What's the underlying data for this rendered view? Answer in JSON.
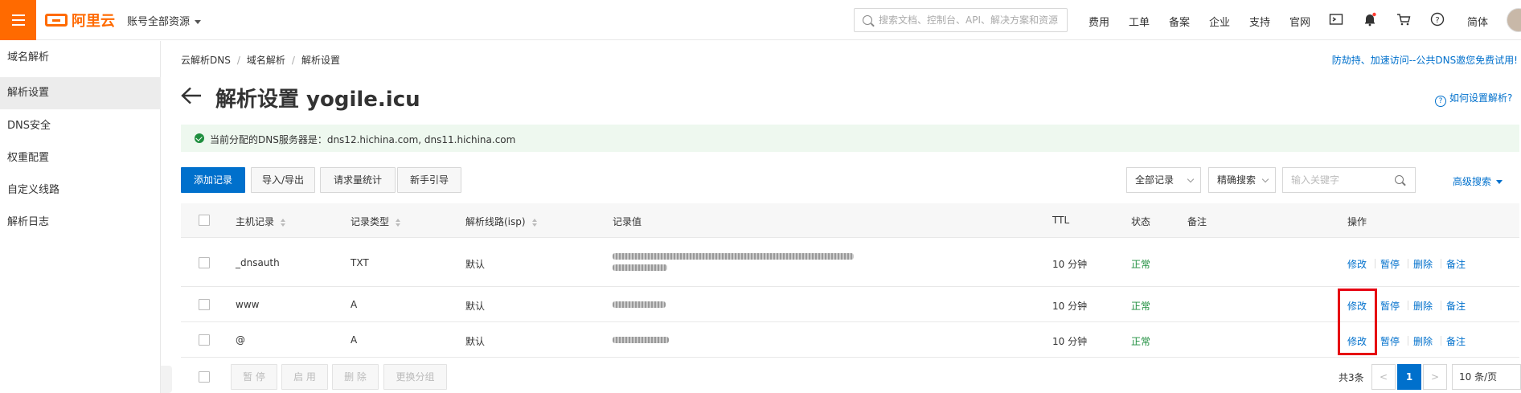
{
  "topbar": {
    "logo_text": "阿里云",
    "account_label": "账号全部资源",
    "search_placeholder": "搜索文档、控制台、API、解决方案和资源",
    "nav": [
      "费用",
      "工单",
      "备案",
      "企业",
      "支持",
      "官网"
    ],
    "lang": "简体"
  },
  "sidebar": {
    "items": [
      {
        "label": "域名解析"
      },
      {
        "label": "解析设置"
      },
      {
        "label": "DNS安全"
      },
      {
        "label": "权重配置"
      },
      {
        "label": "自定义线路"
      },
      {
        "label": "解析日志"
      }
    ]
  },
  "breadcrumb": [
    "云解析DNS",
    "域名解析",
    "解析设置"
  ],
  "promo_link": "防劫持、加速访问--公共DNS邀您免费试用!",
  "page_title": "解析设置 yogile.icu",
  "help_link": "如何设置解析?",
  "notice": "当前分配的DNS服务器是：dns12.hichina.com, dns11.hichina.com",
  "toolbar": {
    "add": "添加记录",
    "import_export": "导入/导出",
    "stats": "请求量统计",
    "guide": "新手引导",
    "filter_all": "全部记录",
    "filter_exact": "精确搜索",
    "keyword_placeholder": "输入关键字",
    "advanced": "高级搜索"
  },
  "table": {
    "headers": {
      "host": "主机记录",
      "type": "记录类型",
      "line": "解析线路(isp)",
      "value": "记录值",
      "ttl": "TTL",
      "status": "状态",
      "remark": "备注",
      "ops": "操作"
    },
    "rows": [
      {
        "host": "_dnsauth",
        "type": "TXT",
        "line": "默认",
        "ttl": "10 分钟",
        "status": "正常"
      },
      {
        "host": "www",
        "type": "A",
        "line": "默认",
        "ttl": "10 分钟",
        "status": "正常"
      },
      {
        "host": "@",
        "type": "A",
        "line": "默认",
        "ttl": "10 分钟",
        "status": "正常"
      }
    ],
    "actions": {
      "edit": "修改",
      "pause": "暂停",
      "delete": "删除",
      "remark": "备注"
    }
  },
  "bulk": {
    "pause": "暂 停",
    "enable": "启 用",
    "delete": "删 除",
    "group": "更换分组"
  },
  "pagination": {
    "total": "共3条",
    "prev": "<",
    "current": "1",
    "next": ">",
    "page_size": "10 条/页"
  },
  "colors": {
    "brand": "#ff6a00",
    "link": "#0070cc",
    "ok": "#1e8e3e",
    "highlight": "#e60012"
  }
}
